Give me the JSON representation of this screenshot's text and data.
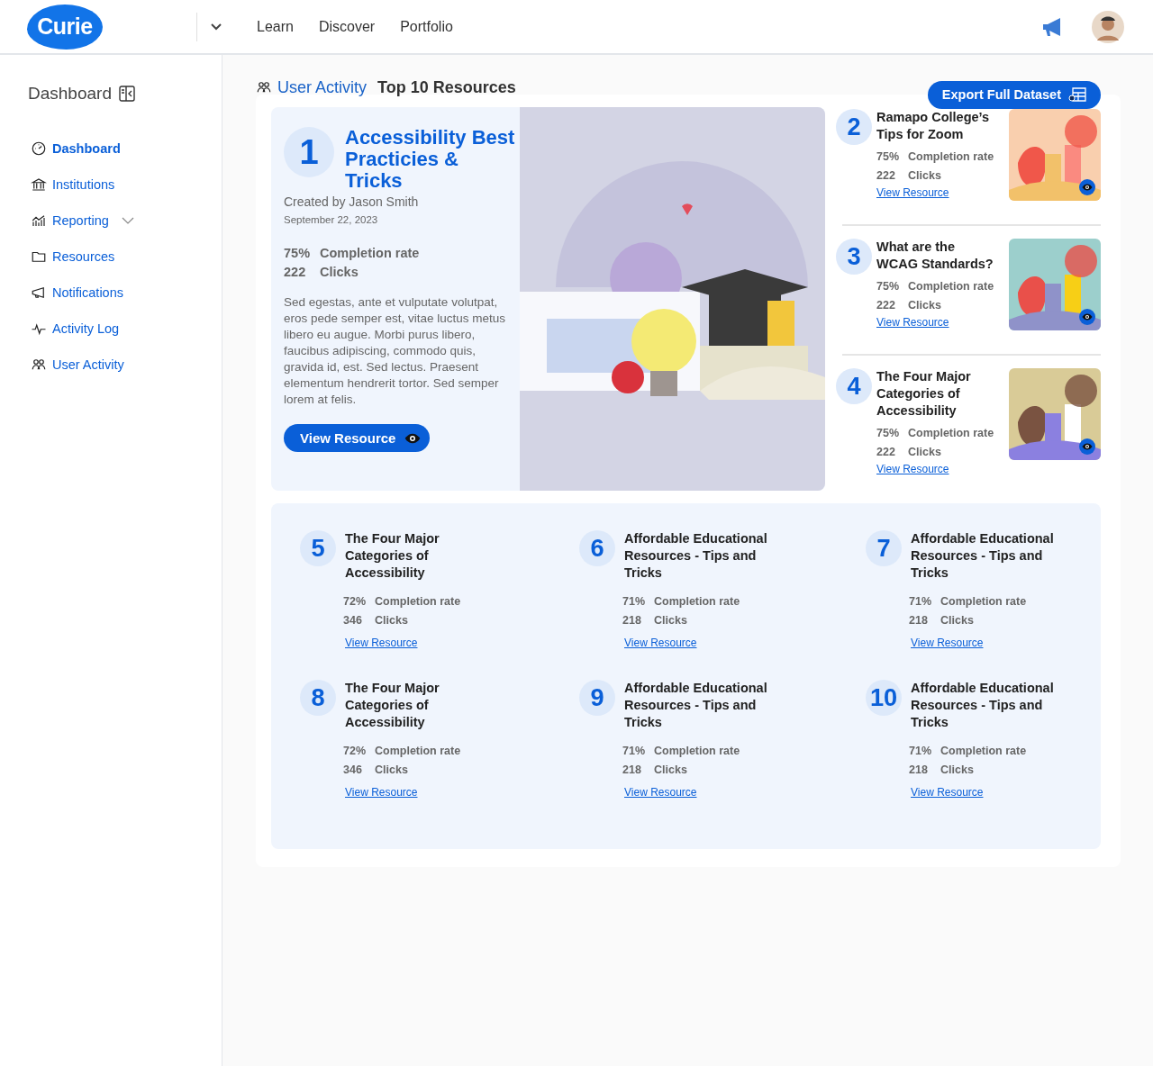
{
  "header": {
    "logo": "Curie",
    "nav": [
      {
        "label": "Learn"
      },
      {
        "label": "Discover"
      },
      {
        "label": "Portfolio"
      }
    ]
  },
  "sidebar": {
    "title": "Dashboard",
    "items": [
      {
        "label": "Dashboard",
        "kind": "link",
        "selected": true
      },
      {
        "label": "Institutions",
        "kind": "link",
        "selected": false
      },
      {
        "label": "Reporting",
        "kind": "group",
        "selected": false
      },
      {
        "label": "Resources",
        "kind": "link",
        "selected": false
      },
      {
        "label": "Notifications",
        "kind": "link",
        "selected": false
      },
      {
        "label": "Activity Log",
        "kind": "link",
        "selected": false
      },
      {
        "label": "User Activity",
        "kind": "link",
        "selected": false
      }
    ]
  },
  "breadcrumb": {
    "section": "User Activity",
    "page": "Top 10 Resources"
  },
  "export_button": "Export Full Dataset",
  "featured": {
    "rank": "1",
    "title": "Accessibility Best Practicies & Tricks",
    "author": "Created by Jason Smith",
    "date": "September 22, 2023",
    "completion": "75%",
    "completion_label": "Completion rate",
    "clicks": "222",
    "clicks_label": "Clicks",
    "description": "Sed egestas, ante et vulputate volutpat, eros pede semper est, vitae luctus metus libero eu augue. Morbi purus libero, faucibus adipiscing, commodo quis, gravida id, est. Sed lectus. Praesent elementum hendrerit tortor. Sed semper lorem at felis.",
    "button": "View Resource"
  },
  "side_resources": [
    {
      "rank": "2",
      "title": "Ramapo College’s Tips for Zoom",
      "completion": "75%",
      "completion_label": "Completion rate",
      "clicks": "222",
      "clicks_label": "Clicks",
      "link": "View Resource"
    },
    {
      "rank": "3",
      "title": "What are the WCAG Standards?",
      "completion": "75%",
      "completion_label": "Completion rate",
      "clicks": "222",
      "clicks_label": "Clicks",
      "link": "View Resource"
    },
    {
      "rank": "4",
      "title": "The Four Major Categories of Accessibility",
      "completion": "75%",
      "completion_label": "Completion rate",
      "clicks": "222",
      "clicks_label": "Clicks",
      "link": "View Resource"
    }
  ],
  "grid_resources": [
    {
      "rank": "5",
      "title": "The Four Major Categories of Accessibility",
      "completion": "72%",
      "completion_label": "Completion rate",
      "clicks": "346",
      "clicks_label": "Clicks",
      "link": "View Resource"
    },
    {
      "rank": "6",
      "title": "Affordable Educational Resources - Tips and Tricks",
      "completion": "71%",
      "completion_label": "Completion rate",
      "clicks": "218",
      "clicks_label": "Clicks",
      "link": "View Resource"
    },
    {
      "rank": "7",
      "title": "Affordable Educational Resources - Tips and Tricks",
      "completion": "71%",
      "completion_label": "Completion rate",
      "clicks": "218",
      "clicks_label": "Clicks",
      "link": "View Resource"
    },
    {
      "rank": "8",
      "title": "The Four Major Categories of Accessibility",
      "completion": "72%",
      "completion_label": "Completion rate",
      "clicks": "346",
      "clicks_label": "Clicks",
      "link": "View Resource"
    },
    {
      "rank": "9",
      "title": "Affordable Educational Resources - Tips and Tricks",
      "completion": "71%",
      "completion_label": "Completion rate",
      "clicks": "218",
      "clicks_label": "Clicks",
      "link": "View Resource"
    },
    {
      "rank": "10",
      "title": "Affordable Educational Resources - Tips and Tricks",
      "completion": "71%",
      "completion_label": "Completion rate",
      "clicks": "218",
      "clicks_label": "Clicks",
      "link": "View Resource"
    }
  ]
}
